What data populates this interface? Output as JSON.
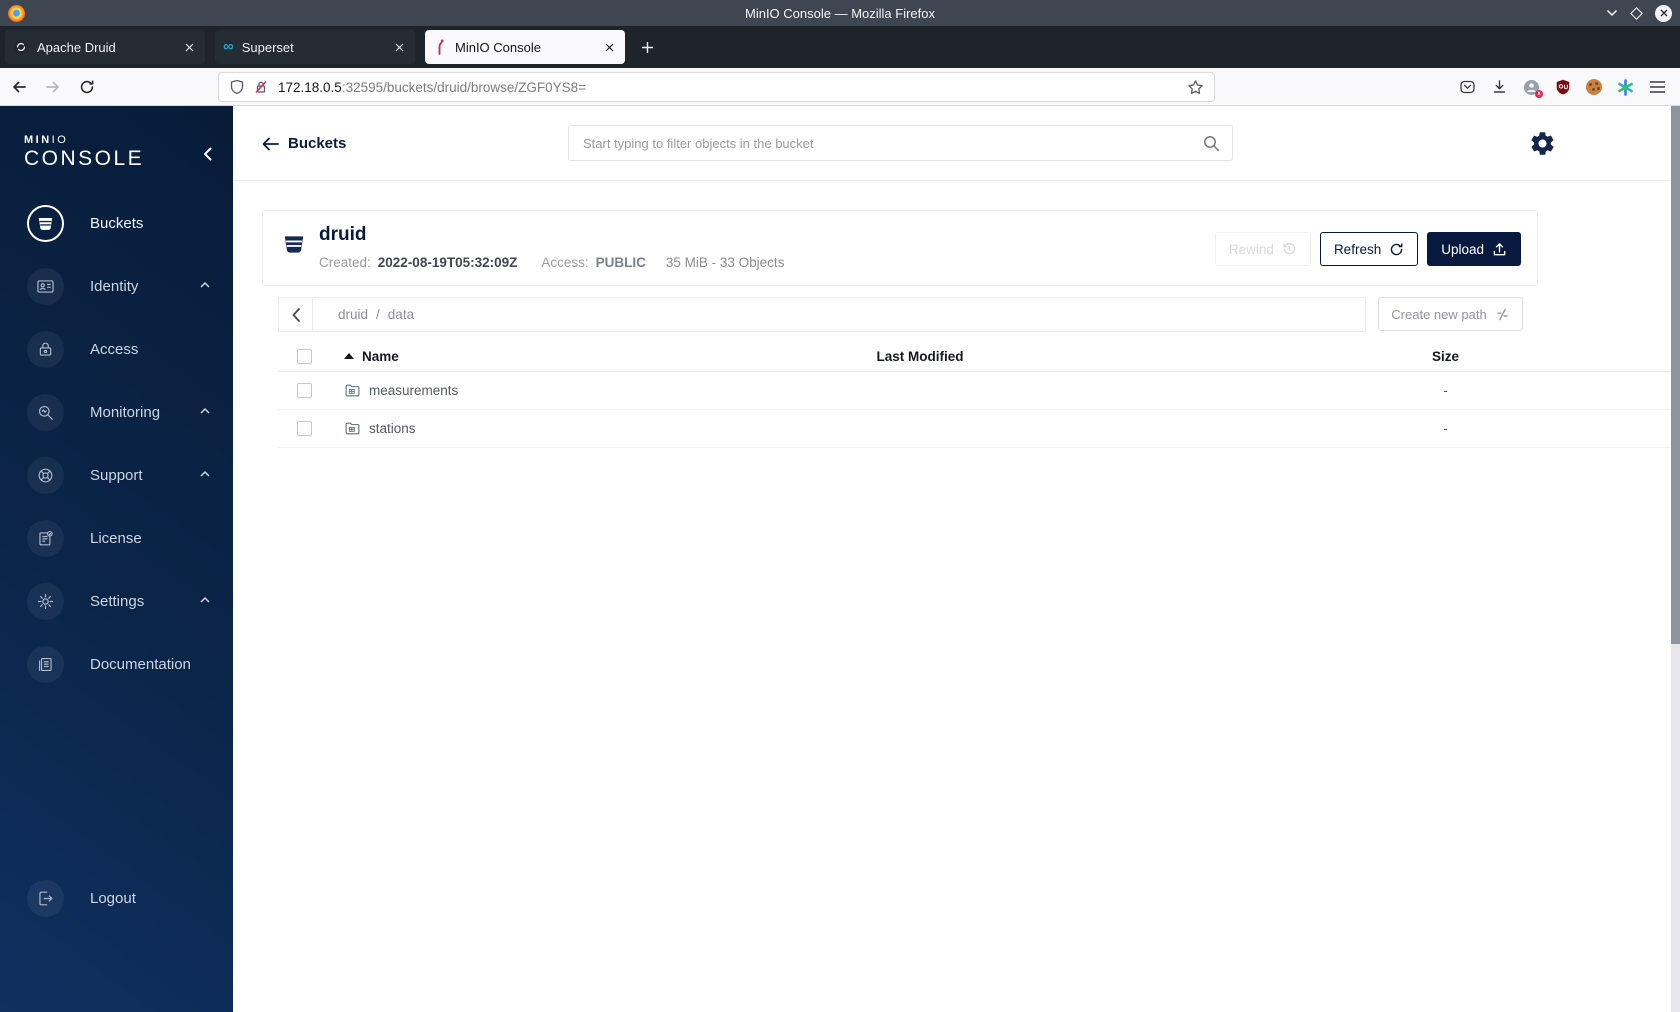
{
  "window": {
    "title": "MinIO Console — Mozilla Firefox"
  },
  "tabbar": {
    "tabs": [
      {
        "label": "Apache Druid"
      },
      {
        "label": "Superset"
      },
      {
        "label": "MinIO Console"
      }
    ]
  },
  "navbar": {
    "url_host": "172.18.0.5",
    "url_rest": ":32595/buckets/druid/browse/ZGF0YS8="
  },
  "sidebar": {
    "brand_top_bold": "MIN",
    "brand_top_light": "IO",
    "brand_bottom": "CONSOLE",
    "items": [
      {
        "label": "Buckets"
      },
      {
        "label": "Identity"
      },
      {
        "label": "Access"
      },
      {
        "label": "Monitoring"
      },
      {
        "label": "Support"
      },
      {
        "label": "License"
      },
      {
        "label": "Settings"
      },
      {
        "label": "Documentation"
      }
    ],
    "logout_label": "Logout"
  },
  "header": {
    "back_label": "Buckets",
    "search_placeholder": "Start typing to filter objects in the bucket"
  },
  "bucket_panel": {
    "title": "druid",
    "created_label": "Created:",
    "created_value": "2022-08-19T05:32:09Z",
    "access_label": "Access:",
    "access_value": "PUBLIC",
    "stats": "35 MiB - 33 Objects",
    "rewind_label": "Rewind",
    "refresh_label": "Refresh",
    "upload_label": "Upload"
  },
  "path_bar": {
    "crumb_root": "druid",
    "crumb_sep": "/",
    "crumb_current": "data",
    "create_path_label": "Create new path"
  },
  "objects_table": {
    "name_header": "Name",
    "modified_header": "Last Modified",
    "size_header": "Size",
    "rows": [
      {
        "name": "measurements",
        "size": "-"
      },
      {
        "name": "stations",
        "size": "-"
      }
    ]
  },
  "colors": {
    "sidebar_navy": "#0b2549",
    "accent_navy": "#07193e",
    "minio_red": "#c72c48",
    "superset_teal": "#1fa8c9"
  }
}
